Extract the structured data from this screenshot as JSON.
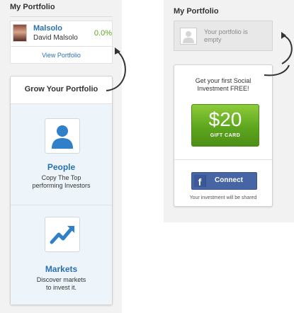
{
  "left": {
    "title": "My Portfolio",
    "user": {
      "username": "Malsolo",
      "full_name": "David Malsolo",
      "gain": "0.0%"
    },
    "view_portfolio": "View Portfolio",
    "grow": {
      "title": "Grow Your Portfolio",
      "people": {
        "title": "People",
        "description": "Copy The Top performing Investors",
        "icon": "person-icon"
      },
      "markets": {
        "title": "Markets",
        "description": "Discover markets to invest it.",
        "icon": "trend-chart-icon"
      }
    }
  },
  "right": {
    "title": "My Portfolio",
    "empty_text": "Your portfolio is empty",
    "offer_text": "Get your first Social Investment FREE!",
    "gift_amount": "$20",
    "gift_label": "GIFT CARD",
    "connect_label": "Connect",
    "connect_note": "Your investment will be shared"
  },
  "colors": {
    "link_blue": "#2a6fb0",
    "gain_green": "#5ca51e",
    "gift_green": "#6cb42c",
    "facebook_blue": "#4764a4"
  }
}
